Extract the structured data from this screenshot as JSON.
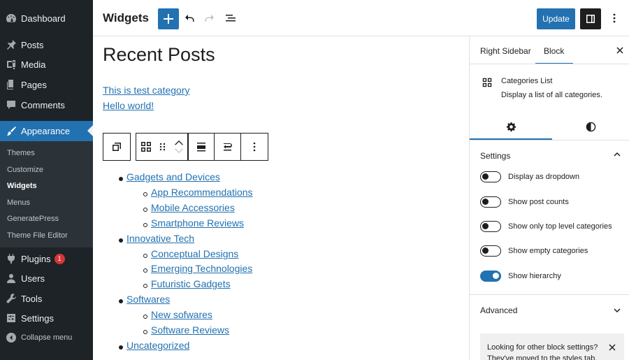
{
  "admin_menu": {
    "items": [
      {
        "label": "Dashboard",
        "icon": "dashboard-icon"
      },
      {
        "label": "Posts",
        "icon": "pin-icon"
      },
      {
        "label": "Media",
        "icon": "media-icon"
      },
      {
        "label": "Pages",
        "icon": "page-icon"
      },
      {
        "label": "Comments",
        "icon": "comment-icon"
      },
      {
        "label": "Appearance",
        "icon": "paintbrush-icon"
      }
    ],
    "submenu": [
      "Themes",
      "Customize",
      "Widgets",
      "Menus",
      "GeneratePress",
      "Theme File Editor"
    ],
    "items2": [
      {
        "label": "Plugins",
        "icon": "plugin-icon",
        "badge": "1"
      },
      {
        "label": "Users",
        "icon": "users-icon"
      },
      {
        "label": "Tools",
        "icon": "wrench-icon"
      },
      {
        "label": "Settings",
        "icon": "settings-icon"
      }
    ],
    "collapse_label": "Collapse menu"
  },
  "header": {
    "title": "Widgets",
    "update_label": "Update"
  },
  "canvas": {
    "widget_title": "Recent Posts",
    "recent_posts": [
      "This is test category",
      "Hello world!"
    ],
    "categories": [
      {
        "name": "Gadgets and Devices",
        "children": [
          "App Recommendations",
          "Mobile Accessories",
          "Smartphone Reviews"
        ]
      },
      {
        "name": "Innovative Tech",
        "children": [
          "Conceptual Designs",
          "Emerging Technologies",
          "Futuristic Gadgets"
        ]
      },
      {
        "name": "Softwares",
        "children": [
          "New sofwares",
          "Software Reviews"
        ]
      },
      {
        "name": "Uncategorized",
        "children": []
      }
    ]
  },
  "sidebar": {
    "tabs": [
      "Right Sidebar",
      "Block"
    ],
    "block_title": "Categories List",
    "block_desc": "Display a list of all categories.",
    "settings_title": "Settings",
    "toggles": [
      {
        "label": "Display as dropdown",
        "on": false
      },
      {
        "label": "Show post counts",
        "on": false
      },
      {
        "label": "Show only top level categories",
        "on": false
      },
      {
        "label": "Show empty categories",
        "on": false
      },
      {
        "label": "Show hierarchy",
        "on": true
      }
    ],
    "advanced_title": "Advanced",
    "notice": "Looking for other block settings? They've moved to the styles tab."
  },
  "colors": {
    "accent": "#2271b1",
    "admin_bg": "#1d2327",
    "badge": "#d63638"
  }
}
